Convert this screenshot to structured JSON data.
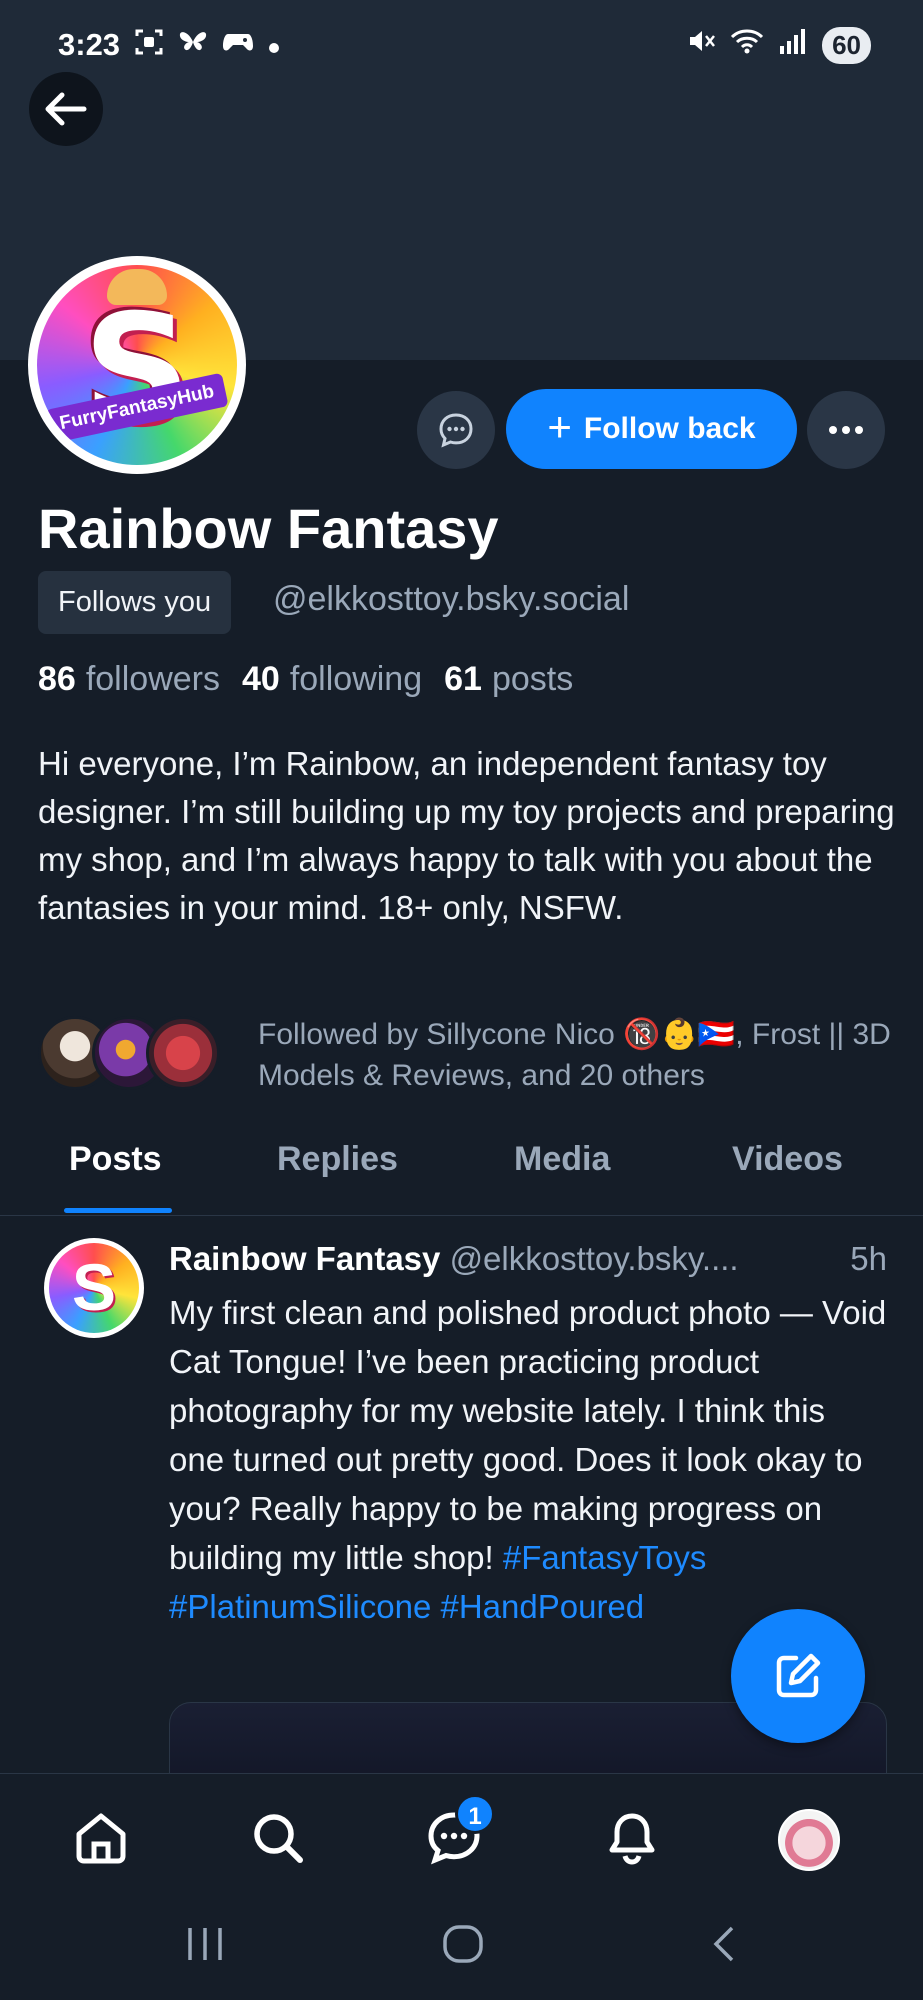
{
  "status_bar": {
    "time": "3:23",
    "battery": "60",
    "left_icons": [
      "screenshot-icon",
      "butterfly-icon",
      "gamepad-icon",
      "dot-icon"
    ],
    "right_icons": [
      "mute-icon",
      "wifi-icon",
      "signal-icon"
    ]
  },
  "profile": {
    "avatar_ribbon_text": "FurryFantasyHub",
    "avatar_letter": "S",
    "follow_button_label": "Follow back",
    "display_name": "Rainbow Fantasy",
    "follows_you_label": "Follows you",
    "handle": "@elkkosttoy.bsky.social",
    "stats": {
      "followers_count": "86",
      "followers_label": "followers",
      "following_count": "40",
      "following_label": "following",
      "posts_count": "61",
      "posts_label": "posts"
    },
    "bio": "Hi everyone, I’m Rainbow, an independent fantasy toy designer. I’m still building up my toy projects and preparing my shop, and I’m always happy to talk with you about the fantasies in your mind. 18+ only, NSFW.",
    "followed_by": "Followed by Sillycone Nico 🔞👶🇵🇷, Frost || 3D Models & Reviews, and 20 others"
  },
  "tabs": [
    {
      "label": "Posts",
      "active": true
    },
    {
      "label": "Replies",
      "active": false
    },
    {
      "label": "Media",
      "active": false
    },
    {
      "label": "Videos",
      "active": false
    }
  ],
  "post": {
    "author_name": "Rainbow Fantasy",
    "author_handle": "@elkkosttoy.bsky....",
    "time": "5h",
    "text": "My first clean and polished product photo — Void Cat Tongue! I’ve been practicing product photography for my website lately. I think this one turned out pretty good. Does it look okay to you? Really happy to be making progress on building my little shop!",
    "hashtags": [
      "#FantasyToys",
      "#PlatinumSilicone",
      "#HandPoured"
    ]
  },
  "bottom_nav": {
    "items": [
      "home-icon",
      "search-icon",
      "chat-icon",
      "bell-icon",
      "profile-avatar"
    ],
    "chat_badge": "1"
  },
  "colors": {
    "background": "#151d28",
    "banner": "#1f2a38",
    "accent": "#1083fe",
    "muted_text": "#9aa8b9",
    "chip": "#26313f"
  }
}
